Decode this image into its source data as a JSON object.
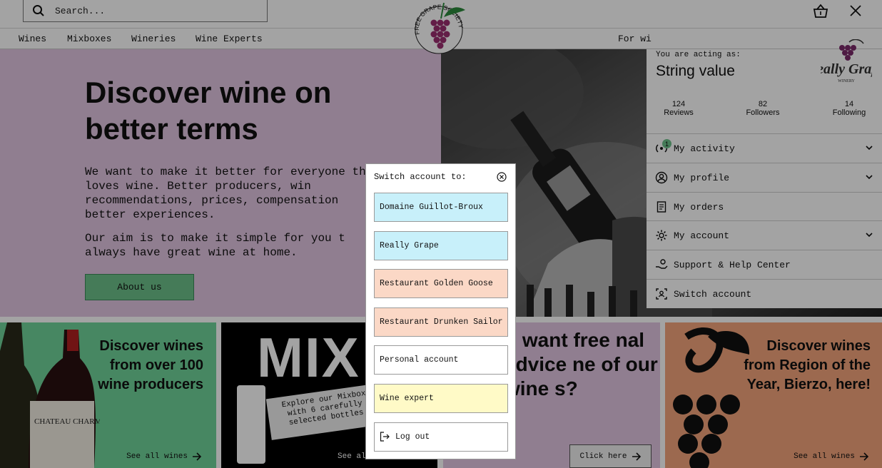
{
  "search": {
    "placeholder": "Search..."
  },
  "logo": {
    "text": "FREE GRAPE SOCIETY"
  },
  "nav": {
    "items": [
      "Wines",
      "Mixboxes",
      "Wineries",
      "Wine Experts"
    ],
    "for_text": "For wi"
  },
  "hero": {
    "title": "Discover wine on better terms",
    "paragraph_1": "We want to make it better for everyone that loves wine. Better producers, win recommendations, prices, compensation better experiences.",
    "paragraph_2": "Our aim is to make it simple for you t always have great wine at home.",
    "button_label": "About us"
  },
  "cards": {
    "wines": {
      "title": "Discover wines from over 100 wine producers",
      "link": "See all wines",
      "label_text": "CHATEAU CHARMAIL"
    },
    "mixbox": {
      "big_text": "MIX",
      "text": "Explore our Mixbox with 6 carefully selected bottles",
      "link": "See al"
    },
    "expert": {
      "title": "u want free nal advice ne of our wine s?",
      "button": "Click here"
    },
    "region": {
      "title": "Discover wines from Region of the Year, Bierzo, here!",
      "link": "See all wines"
    }
  },
  "account_panel": {
    "acting_label": "You are acting as:",
    "acting_name": "String value",
    "winery_logo_text": "Really Grape",
    "winery_logo_sub": "WINERY",
    "stats": [
      {
        "value": "124",
        "label": "Reviews"
      },
      {
        "value": "82",
        "label": "Followers"
      },
      {
        "value": "14",
        "label": "Following"
      }
    ],
    "menu": [
      {
        "label": "My activity",
        "icon": "broadcast-icon",
        "badge": "1",
        "expandable": true
      },
      {
        "label": "My profile",
        "icon": "user-circle-icon",
        "expandable": true
      },
      {
        "label": "My orders",
        "icon": "receipt-icon",
        "expandable": false
      },
      {
        "label": "My account",
        "icon": "gear-icon",
        "expandable": true
      },
      {
        "label": "Support & Help Center",
        "icon": "helping-hand-icon",
        "expandable": false
      },
      {
        "label": "Switch account",
        "icon": "switch-user-icon",
        "expandable": false
      }
    ]
  },
  "switch_modal": {
    "title": "Switch account to:",
    "options": [
      {
        "label": "Domaine Guillot-Broux",
        "color": "#c8f0fa"
      },
      {
        "label": "Really Grape",
        "color": "#c8f0fa"
      },
      {
        "label": "Restaurant Golden Goose",
        "color": "#fbd8c6"
      },
      {
        "label": "Restaurant Drunken Sailor",
        "color": "#fbd8c6"
      },
      {
        "label": "Personal account",
        "color": "#ffffff"
      },
      {
        "label": "Wine expert",
        "color": "#fffac7"
      },
      {
        "label": "Log out",
        "color": "#ffffff"
      }
    ]
  },
  "colors": {
    "green": "#6cc08a",
    "lilac": "#e2c6e2",
    "orange": "#f4a57c",
    "mint": "#6fd39a"
  }
}
